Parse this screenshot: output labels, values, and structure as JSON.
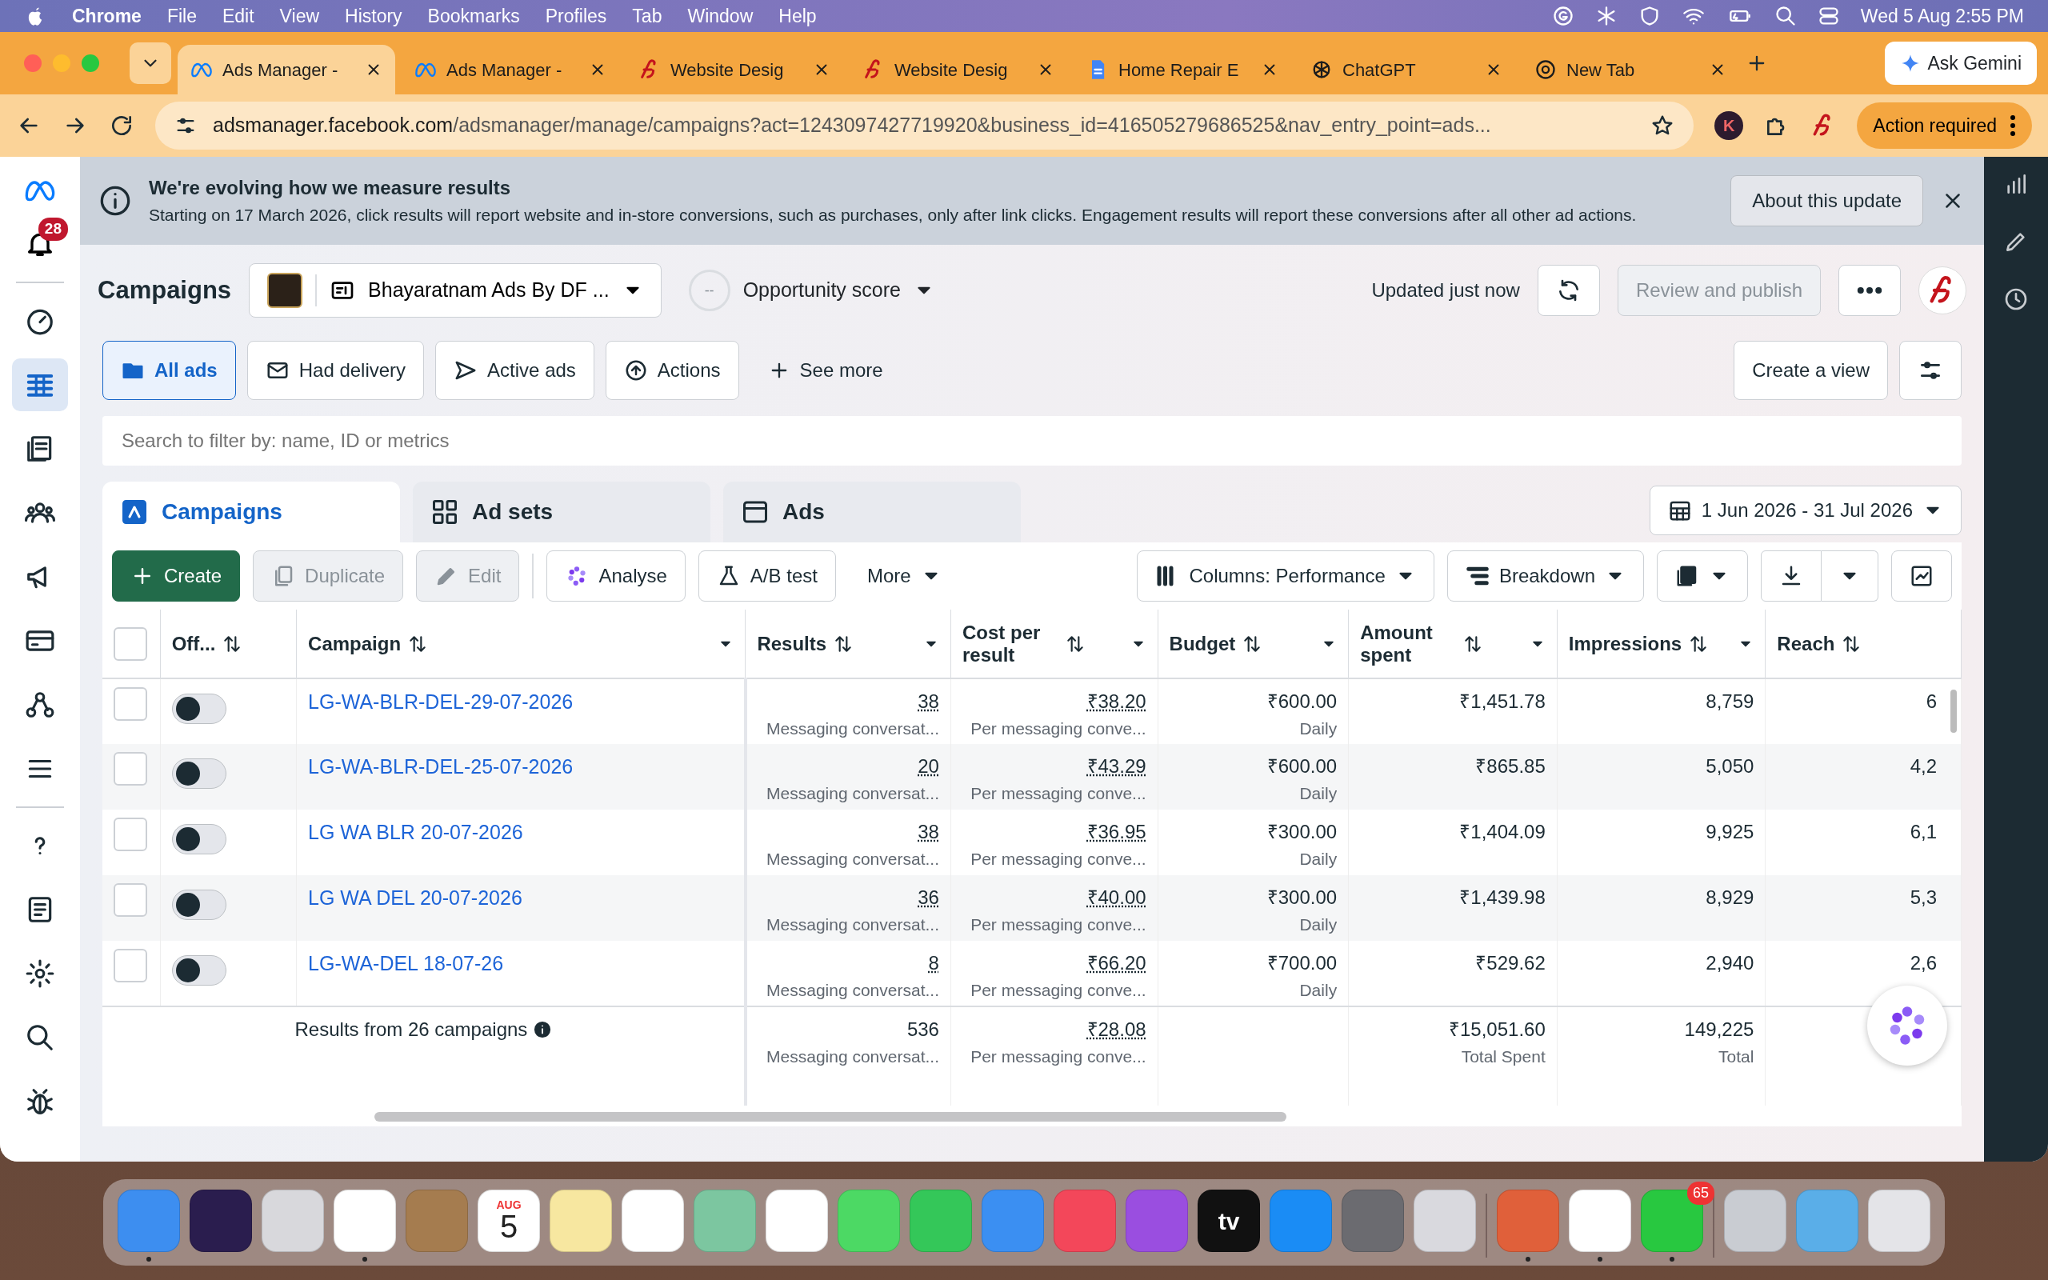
{
  "menubar": {
    "app_name": "Chrome",
    "menus": [
      "File",
      "Edit",
      "View",
      "History",
      "Bookmarks",
      "Profiles",
      "Tab",
      "Window",
      "Help"
    ],
    "clock": "Wed 5 Aug  2:55 PM"
  },
  "browser_tabs": [
    {
      "title": "Ads Manager -",
      "selected": true
    },
    {
      "title": "Ads Manager -",
      "selected": false
    },
    {
      "title": "Website Desig",
      "selected": false
    },
    {
      "title": "Website Desig",
      "selected": false
    },
    {
      "title": "Home Repair E",
      "selected": false
    },
    {
      "title": "ChatGPT",
      "selected": false
    },
    {
      "title": "New Tab",
      "selected": false
    }
  ],
  "gemini_button": "Ask Gemini",
  "address_bar": {
    "host": "adsmanager.facebook.com",
    "path": "/adsmanager/manage/campaigns?act=1243097427719920&business_id=416505279686525&nav_entry_point=ads...",
    "profile_initial": "K",
    "action_required": "Action required"
  },
  "sidebar": {
    "notification_count": "28",
    "items": [
      {
        "selected": false
      },
      {
        "selected": true
      },
      {
        "selected": false
      },
      {
        "selected": false
      },
      {
        "selected": false
      },
      {
        "selected": false
      },
      {
        "selected": false
      },
      {
        "selected": false
      },
      {
        "selected": false
      },
      {
        "selected": false
      },
      {
        "selected": false
      },
      {
        "selected": false
      },
      {
        "selected": false
      }
    ]
  },
  "banner": {
    "title": "We're evolving how we measure results",
    "text": "Starting on 17 March 2026, click results will report website and in-store conversions, such as purchases, only after link clicks. Engagement results will report these conversions after all other ad actions.",
    "button": "About this update"
  },
  "header": {
    "title": "Campaigns",
    "account": "Bhayaratnam Ads By DF ...",
    "score": "--",
    "score_label": "Opportunity score",
    "updated": "Updated just now",
    "review_button": {
      "label": "Review and publish",
      "disabled": true
    }
  },
  "filters": [
    {
      "label": "All ads",
      "selected": true
    },
    {
      "label": "Had delivery",
      "selected": false
    },
    {
      "label": "Active ads",
      "selected": false
    },
    {
      "label": "Actions",
      "selected": false
    }
  ],
  "see_more": "See more",
  "create_view": "Create a view",
  "search": {
    "placeholder": "Search to filter by: name, ID or metrics"
  },
  "level_tabs": [
    {
      "label": "Campaigns",
      "selected": true
    },
    {
      "label": "Ad sets",
      "selected": false
    },
    {
      "label": "Ads",
      "selected": false
    }
  ],
  "date_range": "1 Jun 2026 - 31 Jul 2026",
  "toolbar": [
    {
      "label": "Create",
      "kind": "primary",
      "disabled": false
    },
    {
      "label": "Duplicate",
      "kind": "button",
      "disabled": true
    },
    {
      "label": "Edit",
      "kind": "button",
      "disabled": true
    },
    {
      "label": "Analyse",
      "kind": "button",
      "disabled": false
    },
    {
      "label": "A/B test",
      "kind": "button",
      "disabled": false
    },
    {
      "label": "More",
      "kind": "menu",
      "disabled": false
    }
  ],
  "columns_button": "Columns: Performance",
  "breakdown_button": "Breakdown",
  "table": {
    "all_selected": false,
    "columns": [
      "Off...",
      "Campaign",
      "Results",
      "Cost per result",
      "Budget",
      "Amount spent",
      "Impressions",
      "Reach"
    ],
    "rows": [
      {
        "checked": false,
        "on": false,
        "campaign": "LG-WA-BLR-DEL-29-07-2026",
        "results": "38",
        "results_type": "Messaging conversat...",
        "cost": "₹38.20",
        "cost_type": "Per messaging conve...",
        "budget": "₹600.00",
        "budget_type": "Daily",
        "amount": "₹1,451.78",
        "impressions": "8,759",
        "reach": "6"
      },
      {
        "checked": false,
        "on": false,
        "campaign": "LG-WA-BLR-DEL-25-07-2026",
        "results": "20",
        "results_type": "Messaging conversat...",
        "cost": "₹43.29",
        "cost_type": "Per messaging conve...",
        "budget": "₹600.00",
        "budget_type": "Daily",
        "amount": "₹865.85",
        "impressions": "5,050",
        "reach": "4,2"
      },
      {
        "checked": false,
        "on": false,
        "campaign": "LG WA BLR 20-07-2026",
        "results": "38",
        "results_type": "Messaging conversat...",
        "cost": "₹36.95",
        "cost_type": "Per messaging conve...",
        "budget": "₹300.00",
        "budget_type": "Daily",
        "amount": "₹1,404.09",
        "impressions": "9,925",
        "reach": "6,1"
      },
      {
        "checked": false,
        "on": false,
        "campaign": "LG WA DEL 20-07-2026",
        "results": "36",
        "results_type": "Messaging conversat...",
        "cost": "₹40.00",
        "cost_type": "Per messaging conve...",
        "budget": "₹300.00",
        "budget_type": "Daily",
        "amount": "₹1,439.98",
        "impressions": "8,929",
        "reach": "5,3"
      },
      {
        "checked": false,
        "on": false,
        "campaign": "LG-WA-DEL 18-07-26",
        "results": "8",
        "results_type": "Messaging conversat...",
        "cost": "₹66.20",
        "cost_type": "Per messaging conve...",
        "budget": "₹700.00",
        "budget_type": "Daily",
        "amount": "₹529.62",
        "impressions": "2,940",
        "reach": "2,6"
      }
    ],
    "footer": {
      "label": "Results from 26 campaigns",
      "results": "536",
      "results_type": "Messaging conversat...",
      "cost": "₹28.08",
      "cost_type": "Per messaging conve...",
      "amount": "₹15,051.60",
      "amount_type": "Total Spent",
      "impressions": "149,225",
      "impressions_type": "Total"
    }
  },
  "dock": [
    {
      "color": "#3d8ef0",
      "running": true
    },
    {
      "color": "#2a1d4e",
      "running": false
    },
    {
      "color": "#d8d8dc",
      "running": false
    },
    {
      "color": "#ffffff",
      "running": true
    },
    {
      "color": "#a57c4f",
      "running": false
    },
    {
      "color": "#ffffff",
      "running": false,
      "month": "AUG",
      "day": "5"
    },
    {
      "color": "#f7e7a0",
      "running": false
    },
    {
      "color": "#ffffff",
      "running": false
    },
    {
      "color": "#7cc6a0",
      "running": false
    },
    {
      "color": "#ffffff",
      "running": false
    },
    {
      "color": "#4cd964",
      "running": false
    },
    {
      "color": "#34c759",
      "running": false
    },
    {
      "color": "#3b8ff2",
      "running": false
    },
    {
      "color": "#f3475a",
      "running": false
    },
    {
      "color": "#9a4ee0",
      "running": false
    },
    {
      "color": "#111111",
      "running": false,
      "label": "tv"
    },
    {
      "color": "#1a8cf5",
      "running": false
    },
    {
      "color": "#6b6b70",
      "running": false
    },
    {
      "color": "#d9d9de",
      "running": false
    },
    {
      "color": "#e0603a",
      "running": true
    },
    {
      "color": "#ffffff",
      "running": true
    },
    {
      "color": "#28c840",
      "running": true,
      "badge": "65"
    },
    {
      "color": "#c9ccd2",
      "running": false
    },
    {
      "color": "#5aaee8",
      "running": false
    },
    {
      "color": "#e4e4e8",
      "running": false
    }
  ]
}
